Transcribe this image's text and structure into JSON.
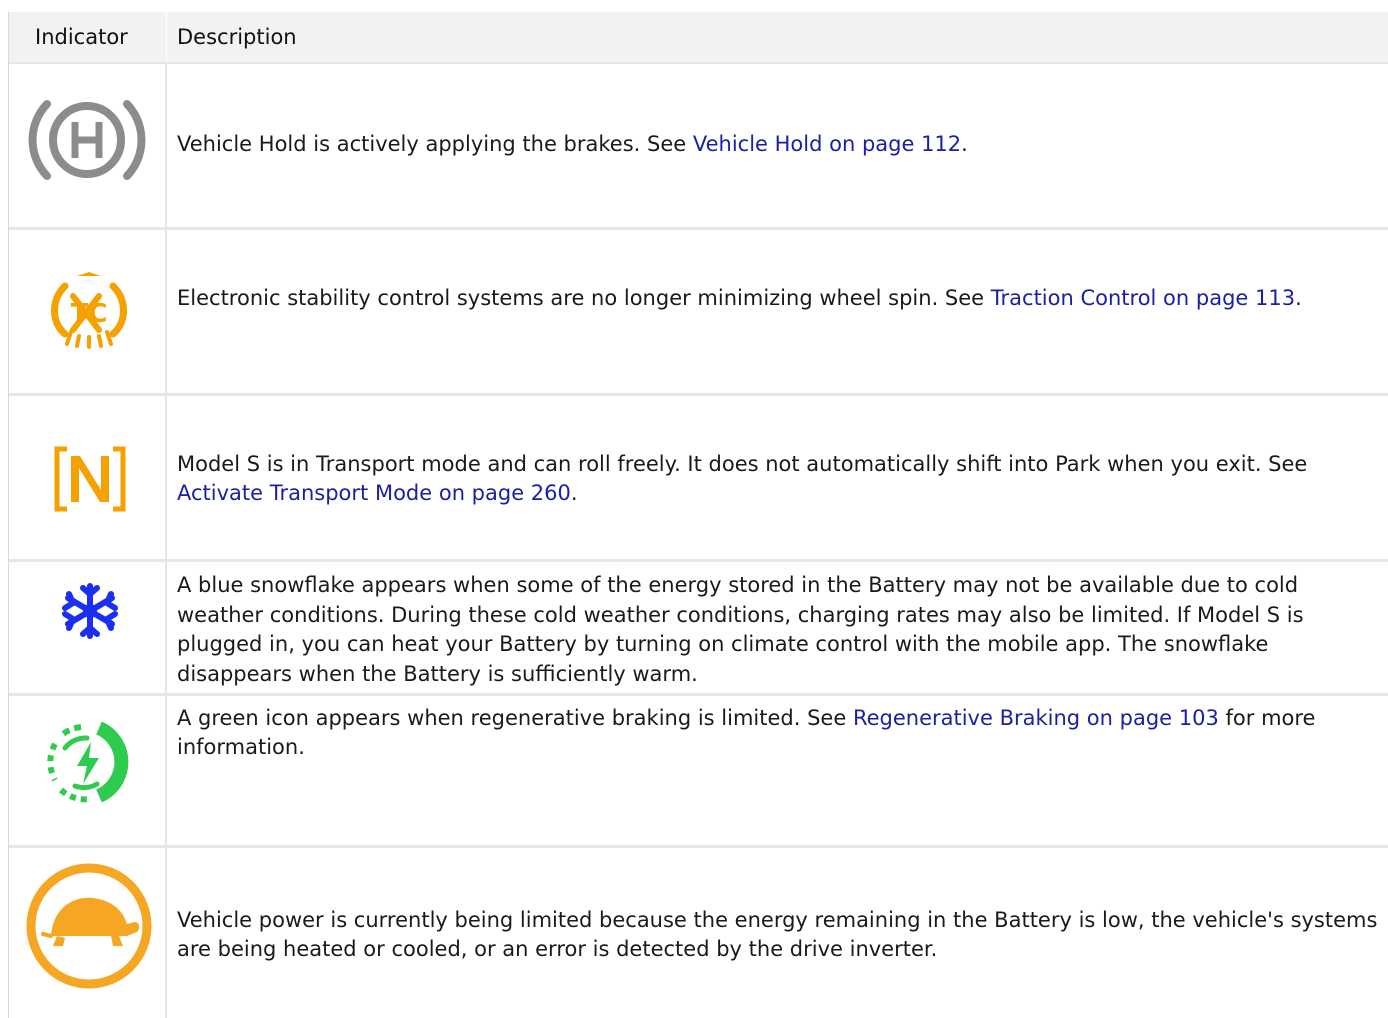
{
  "header": {
    "col_indicator": "Indicator",
    "col_description": "Description"
  },
  "rows": [
    {
      "icon": "vehicle-hold-icon",
      "color": "#8c8c8c",
      "text_before": "Vehicle Hold is actively applying the brakes. See ",
      "link": "Vehicle Hold on page 112",
      "text_after": "."
    },
    {
      "icon": "traction-control-icon",
      "color": "#f5a100",
      "text_before": "Electronic stability control systems are no longer minimizing wheel spin. See ",
      "link": "Traction Control on page 113",
      "text_after": "."
    },
    {
      "icon": "transport-mode-icon",
      "color": "#f5a100",
      "text_before": "Model S is in Transport mode and can roll freely. It does not automatically shift into Park when you exit. See ",
      "link": "Activate Transport Mode on page 260",
      "text_after": "."
    },
    {
      "icon": "snowflake-icon",
      "color": "#1a2ff0",
      "text_before": "A blue snowflake appears when some of the energy stored in the Battery may not be available due to cold weather conditions. During these cold weather conditions, charging rates may also be limited. If Model S is plugged in, you can heat your Battery by turning on climate control with the mobile app. The snowflake disappears when the Battery is sufficiently warm.",
      "link": "",
      "text_after": ""
    },
    {
      "icon": "regen-braking-limited-icon",
      "color": "#2ecc4e",
      "text_before": "A green icon appears when regenerative braking is limited. See ",
      "link": "Regenerative Braking on page 103",
      "text_after": " for more information."
    },
    {
      "icon": "reduced-power-turtle-icon",
      "color": "#f5a623",
      "text_before": "Vehicle power is currently being limited because the energy remaining in the Battery is low, the vehicle's systems are being heated or cooled, or an error is detected by the drive inverter.",
      "link": "",
      "text_after": ""
    }
  ]
}
